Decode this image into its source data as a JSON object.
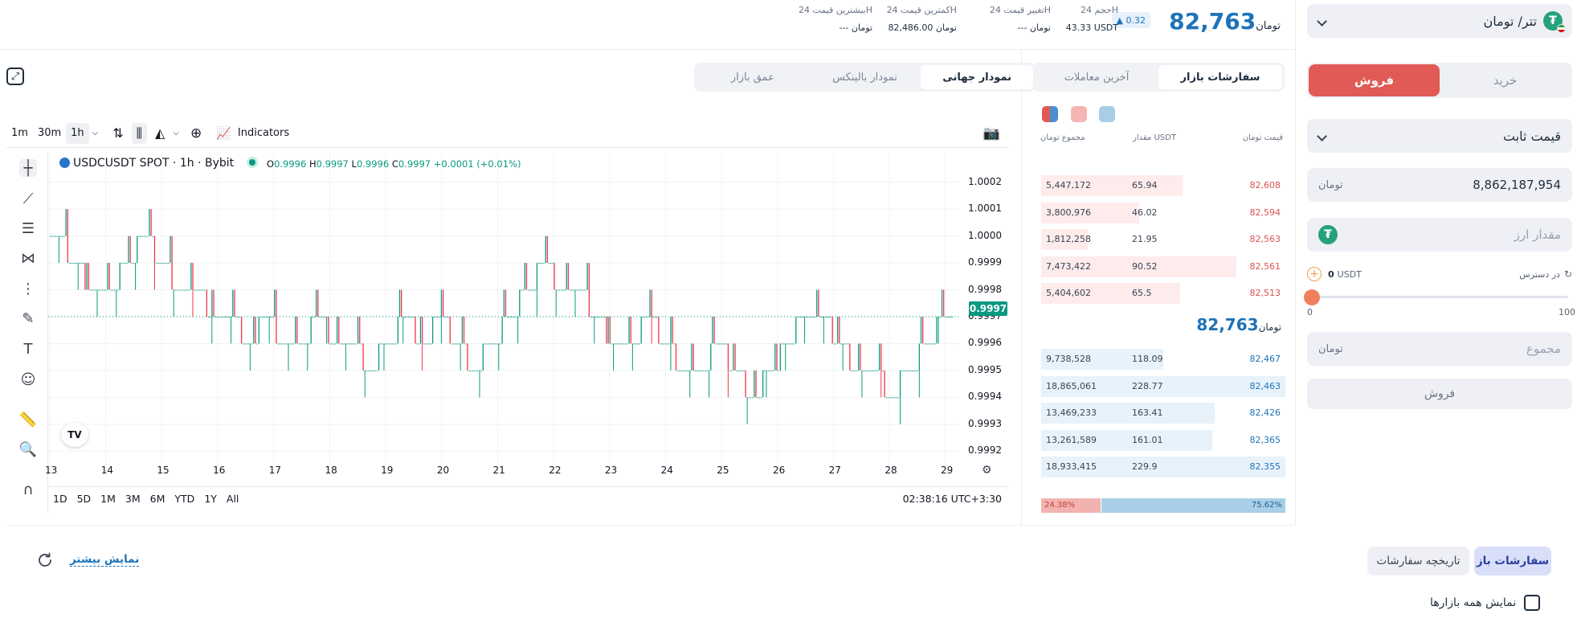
{
  "header": {
    "pair_label": "تتر/ تومان",
    "last_price": "82,763",
    "currency_symbol": "تومان",
    "change_percent": "0.32",
    "stats": [
      {
        "key": "حجم 24H",
        "value": "43.33 USDT"
      },
      {
        "key": "تغییر قیمت 24H",
        "value": "--- تومان"
      },
      {
        "key": "کمترین قیمت 24H",
        "value": "82,486.00 تومان"
      },
      {
        "key": "بیشترین قیمت 24H",
        "value": "--- تومان"
      }
    ]
  },
  "trade_panel": {
    "buy_label": "خرید",
    "sell_label": "فروش",
    "order_type": "قیمت ثابت",
    "price_value": "8,862,187,954",
    "amount_placeholder": "مقدار ارز",
    "available_label": "در دسترس",
    "available_value": "0",
    "available_unit": "USDT",
    "slider_min": "0",
    "slider_max": "100",
    "slider_value": 0,
    "total_placeholder": "مجموع",
    "submit_label": "فروش"
  },
  "order_book": {
    "tabs": [
      "سفارشات بازار",
      "آخرین معاملات"
    ],
    "active_tab": 0,
    "headers": {
      "price": "قیمت",
      "amount": "مقدار USDT",
      "total": "مجموع"
    },
    "asks": [
      {
        "price": "82,608",
        "amount": "65.94",
        "total": "5,447,172",
        "depth": 0.58
      },
      {
        "price": "82,594",
        "amount": "46.02",
        "total": "3,800,976",
        "depth": 0.4
      },
      {
        "price": "82,563",
        "amount": "21.95",
        "total": "1,812,258",
        "depth": 0.19
      },
      {
        "price": "82,561",
        "amount": "90.52",
        "total": "7,473,422",
        "depth": 0.8
      },
      {
        "price": "82,513",
        "amount": "65.5",
        "total": "5,404,602",
        "depth": 0.57
      }
    ],
    "mid_price": "82,763",
    "bids": [
      {
        "price": "82,467",
        "amount": "118.09",
        "total": "9,738,528",
        "depth": 0.5
      },
      {
        "price": "82,463",
        "amount": "228.77",
        "total": "18,865,061",
        "depth": 1.0
      },
      {
        "price": "82,426",
        "amount": "163.41",
        "total": "13,469,233",
        "depth": 0.71
      },
      {
        "price": "82,365",
        "amount": "161.01",
        "total": "13,261,589",
        "depth": 0.7
      },
      {
        "price": "82,355",
        "amount": "229.9",
        "total": "18,933,415",
        "depth": 1.0
      }
    ],
    "sell_ratio": "24.38%",
    "buy_ratio": "75.62%"
  },
  "chart_tabs": [
    "نمودار جهانی",
    "نمودار بالینکس",
    "عمق بازار"
  ],
  "tv": {
    "timeframes": [
      "1m",
      "30m",
      "1h"
    ],
    "active_tf": "1h",
    "indicators_label": "Indicators",
    "symbol": "USDCUSDT SPOT · 1h · Bybit",
    "ohlc": {
      "o": "0.9996",
      "h": "0.9997",
      "l": "0.9996",
      "c": "0.9997",
      "chg": "+0.0001 (+0.01%)"
    },
    "current_price": "0.9997",
    "ranges": [
      "1D",
      "5D",
      "1M",
      "3M",
      "6M",
      "YTD",
      "1Y",
      "All"
    ],
    "clock": "02:38:16 UTC+3:30"
  },
  "chart_data": {
    "type": "candlestick",
    "x_ticks": [
      "13",
      "14",
      "15",
      "16",
      "17",
      "18",
      "19",
      "20",
      "21",
      "22",
      "23",
      "24",
      "25",
      "26",
      "27",
      "28",
      "29"
    ],
    "y_ticks": [
      "1.0002",
      "1.0001",
      "1.0000",
      "0.9999",
      "0.9998",
      "0.9997",
      "0.9996",
      "0.9995",
      "0.9994",
      "0.9993",
      "0.9992"
    ],
    "ylim": [
      0.99915,
      1.00025
    ],
    "close_levels": [
      1.0,
      0.9999,
      0.9998,
      0.9998,
      0.9999,
      1.0,
      0.9999,
      0.9998,
      0.9998,
      0.9997,
      0.9997,
      0.9996,
      0.9997,
      0.9996,
      0.9996,
      0.9997,
      0.9996,
      0.9996,
      0.9995,
      0.9996,
      0.9997,
      0.9996,
      0.9997,
      0.9996,
      0.9995,
      0.9996,
      0.9997,
      0.9998,
      0.9999,
      0.9998,
      0.9998,
      0.9997,
      0.9996,
      0.9996,
      0.9997,
      0.9996,
      0.9995,
      0.9995,
      0.9996,
      0.9995,
      0.9994,
      0.9995,
      0.9996,
      0.9997,
      0.9997,
      0.9996,
      0.9995,
      0.9995,
      0.9994,
      0.9995,
      0.9996,
      0.9997
    ],
    "colors": {
      "up": "#089981",
      "down": "#f23645"
    }
  },
  "bottom": {
    "tab_open": "سفارشات باز",
    "tab_history": "تاریخچه سفارشات",
    "show_more": "نمایش بیشتر",
    "show_all_markets": "نمایش همه بازارها"
  }
}
